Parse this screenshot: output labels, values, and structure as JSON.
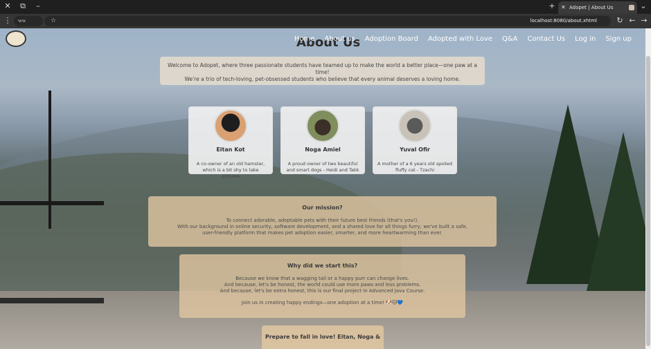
{
  "browser": {
    "tab_title": "Adopet | About Us",
    "url": "localhost:8080/about.xhtml",
    "profile_label": "אישי"
  },
  "site": {
    "page_title": "About Us",
    "nav": [
      "Home",
      "About us",
      "Adoption Board",
      "Adopted with Love",
      "Q&A",
      "Contact Us",
      "Log in",
      "Sign up"
    ]
  },
  "welcome": {
    "line1": "Welcome to Adopet, where three passionate students have teamed up to make the world a better place—one paw at a time!",
    "line2": "We're a trio of tech-loving, pet-obsessed students who believe that every animal deserves a loving home."
  },
  "people": [
    {
      "name": "Eitan Kot",
      "bio1": "A co-owner of an old hamster,",
      "bio2": "which is a bit shy to take pictures"
    },
    {
      "name": "Noga Amiel",
      "bio1": "A proud owner of two beautiful",
      "bio2": "and smart dogs - Heidi and Takk"
    },
    {
      "name": "Yuval Ofir",
      "bio1": "A mother of a 6 years old spoiled",
      "bio2": "fluffy cat - Tzachi"
    }
  ],
  "mission": {
    "title": "Our mission?",
    "line1": "To connect adorable, adoptable pets with their future best friends (that's you!).",
    "line2": "With our background in online security, software development, and a shared love for all things furry, we've built a safe,",
    "line3": "user-friendly platform that makes pet adoption easier, smarter, and more heartwarming than ever."
  },
  "why": {
    "title": "Why did we start this?",
    "line1": "Because we know that a wagging tail or a happy purr can change lives.",
    "line2": "And because, let's be honest, the world could use more paws and less problems.",
    "line3": "And because, let's be extra honest, this is our final project in Advanced Java Course.",
    "line4": "Join us in creating happy endings—one adoption at a time! 🐶🐱💙"
  },
  "footer": {
    "banner": "Prepare to fall in love! Eitan, Noga & Yuval"
  }
}
